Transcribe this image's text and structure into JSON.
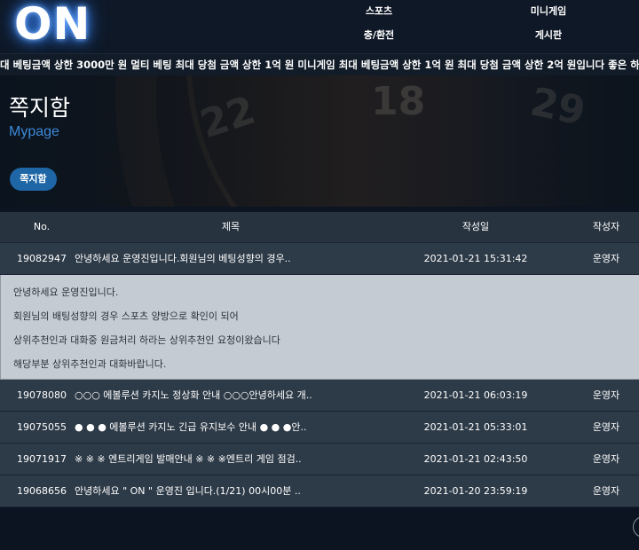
{
  "header": {
    "logo": "ON",
    "nav": {
      "sports": "스포츠",
      "mini_game": "미니게임",
      "deposit_withdraw": "충/환전",
      "board": "게시판"
    }
  },
  "ticker": {
    "text": "대 베팅금액 상한 3000만 원 멀티 베팅 최대 당첨 금액 상한 1억 원 미니게임 최대 베팅금액 상한 1억 원 최대 당첨 금액 상한 2억 원입니다 좋은 하루 보내시기 바랍니다. ▷▶"
  },
  "banner": {
    "title": "쪽지함",
    "subtitle": "Mypage",
    "tab_label": "쪽지함",
    "wheel_numbers": [
      "22",
      "18",
      "29"
    ]
  },
  "table": {
    "headers": {
      "no": "No.",
      "title": "제목",
      "date": "작성일",
      "author": "작성자"
    },
    "first_row": {
      "no": "19082947",
      "title": "안녕하세요 운영진입니다.회원님의 베팅성향의 경우..",
      "date": "2021-01-21 15:31:42",
      "author": "운영자"
    },
    "message": {
      "line1": "안녕하세요 운영진입니다.",
      "line2": "회원님의 배팅성향의 경우 스포츠 양방으로 확인이 되어",
      "line3": "상위추천인과 대화중 원금처리 하라는 상위추천인 요청이왔습니다",
      "line4": "해당부분 상위추천인과 대화바랍니다."
    },
    "rows": [
      {
        "no": "19078080",
        "title": "○○○ 에볼루션 카지노 정상화 안내 ○○○안녕하세요 개..",
        "date": "2021-01-21 06:03:19",
        "author": "운영자"
      },
      {
        "no": "19075055",
        "title": "● ● ● 에볼루션 카지노 긴급 유지보수 안내 ● ● ●안..",
        "date": "2021-01-21 05:33:01",
        "author": "운영자"
      },
      {
        "no": "19071917",
        "title": "※ ※ ※ 엔트리게임 발매안내 ※ ※ ※엔트리 게임 점검..",
        "date": "2021-01-21 02:43:50",
        "author": "운영자"
      },
      {
        "no": "19068656",
        "title": "안녕하세요 \" ON \" 운영진 입니다.(1/21) 00시00분 ..",
        "date": "2021-01-20 23:59:19",
        "author": "운영자"
      }
    ]
  },
  "colors": {
    "background": "#0b1420",
    "accent_blue": "#1e66a6",
    "subtitle_blue": "#3c88d8",
    "row_bg": "#2d3a47",
    "message_bg": "#c4cbd2"
  }
}
